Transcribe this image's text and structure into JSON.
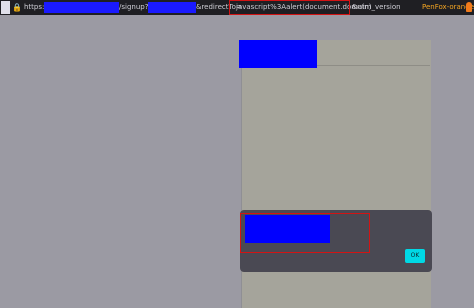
{
  "address_bar": {
    "scheme": "https://",
    "path_signup": "/signup?",
    "redirect_param": "&redirectTo=",
    "payload": "javascript%3Aalert(document.domain)",
    "utm_param": "&utm_version",
    "profile_name": "PenFox-orange",
    "icons": [
      "shield-icon",
      "lock-icon",
      "profile-flame-icon"
    ]
  },
  "alert_dialog": {
    "ok_label": "OK"
  },
  "colors": {
    "redaction": "#0000ff",
    "highlight_box": "#d21414",
    "ok_button": "#00d9e5",
    "dialog_bg": "#4a4953",
    "overlay": "#9b9aa3"
  }
}
